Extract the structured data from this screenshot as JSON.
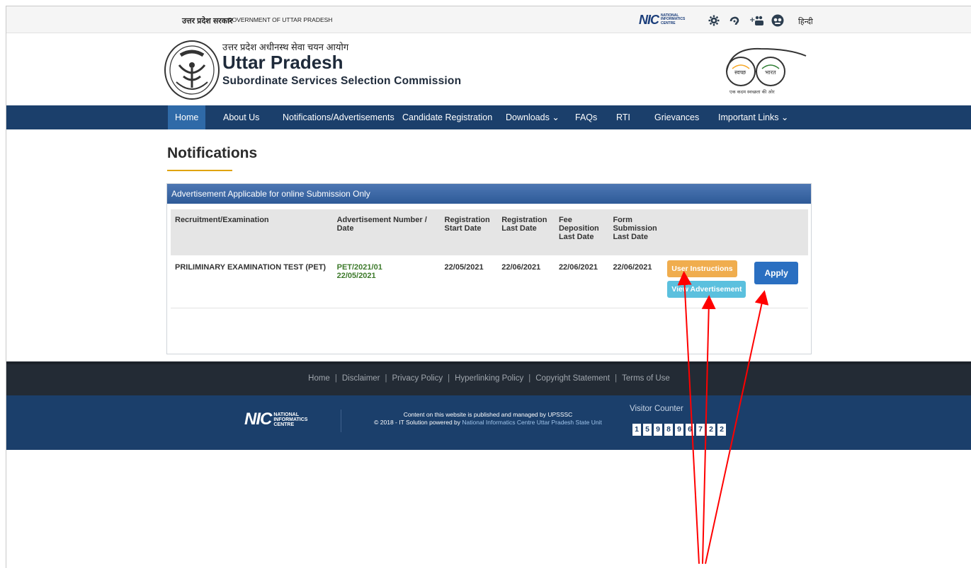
{
  "topbar": {
    "gov_hindi": "उत्तर प्रदेश सरकार",
    "gov_english": "GOVERNMENT OF UTTAR PRADESH",
    "nic_logo": {
      "letters": "NIC",
      "words": [
        "NATIONAL",
        "INFORMATICS",
        "CENTRE"
      ]
    },
    "icons": [
      "gear-icon",
      "screen-reader-icon",
      "font-size-icon",
      "contrast-icon"
    ],
    "language_link": "हिन्दी"
  },
  "header": {
    "hindi_name": "उत्तर प्रदेश अधीनस्थ सेवा चयन आयोग",
    "title": "Uttar Pradesh",
    "subtitle": "Subordinate Services Selection Commission",
    "swachh_logo": {
      "word_left": "स्वच्छ",
      "word_right": "भारत",
      "tagline": "एक कदम स्वच्छता की ओर"
    }
  },
  "nav": {
    "items": [
      {
        "label": "Home",
        "active": true
      },
      {
        "label": "About Us"
      },
      {
        "label": "Notifications/Advertisements"
      },
      {
        "label": "Candidate Registration"
      },
      {
        "label": "Downloads ⌄"
      },
      {
        "label": "FAQs"
      },
      {
        "label": "RTI"
      },
      {
        "label": "Grievances"
      },
      {
        "label": "Important Links ⌄"
      }
    ]
  },
  "main": {
    "page_title": "Notifications",
    "panel_title": "Advertisement Applicable for online Submission Only",
    "table": {
      "headers": [
        "Recruitment/Examination",
        "Advertisement Number / Date",
        "Registration Start Date",
        "Registration Last Date",
        "Fee Deposition Last Date",
        "Form Submission Last Date",
        "",
        ""
      ],
      "rows": [
        {
          "exam": "PRILIMINARY EXAMINATION TEST (PET)",
          "adv_number": "PET/2021/01",
          "adv_date": "22/05/2021",
          "reg_start": "22/05/2021",
          "reg_last": "22/06/2021",
          "fee_last": "22/06/2021",
          "form_last": "22/06/2021",
          "user_instructions_label": "User Instructions",
          "view_adv_label": "View Advertisement",
          "apply_label": "Apply"
        }
      ]
    }
  },
  "footer": {
    "links": [
      "Home",
      "Disclaimer",
      "Privacy Policy",
      "Hyperlinking Policy",
      "Copyright Statement",
      "Terms of Use"
    ],
    "content_line1": "Content on this website is published and managed by UPSSSC",
    "content_line2_prefix": "© 2018 - IT Solution powered by ",
    "content_line2_link": "National Informatics Centre Uttar Pradesh State Unit",
    "visitor_counter_label": "Visitor Counter",
    "visitor_digits": [
      "1",
      "5",
      "9",
      "8",
      "9",
      "6",
      "7",
      "2",
      "2"
    ]
  },
  "colors": {
    "nav_bg": "#1b3f6b",
    "nav_active": "#2f6aa8",
    "accent_underline": "#e0a300",
    "btn_user_instructions": "#f0ad4e",
    "btn_view_advertisement": "#5bc0de",
    "btn_apply": "#2a6fc1",
    "annotation_arrows": "#ff0000"
  }
}
